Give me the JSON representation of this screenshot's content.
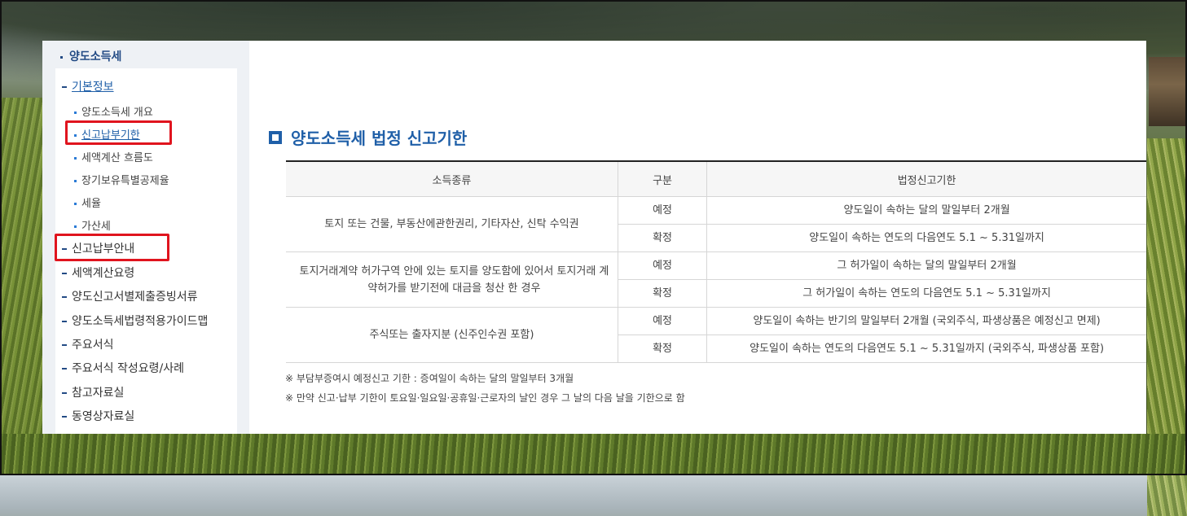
{
  "sidebar": {
    "title": "양도소득세",
    "sections": [
      {
        "label": "기본정보"
      },
      {
        "label": "신고납부안내"
      },
      {
        "label": "세액계산요령"
      },
      {
        "label": "양도신고서별제출증빙서류"
      },
      {
        "label": "양도소득세법령적용가이드맵"
      },
      {
        "label": "주요서식"
      },
      {
        "label": "주요서식 작성요령/사례"
      },
      {
        "label": "참고자료실"
      },
      {
        "label": "동영상자료실"
      }
    ],
    "sub_items": [
      {
        "label": "양도소득세 개요"
      },
      {
        "label": "신고납부기한"
      },
      {
        "label": "세액계산 흐름도"
      },
      {
        "label": "장기보유특별공제율"
      },
      {
        "label": "세율"
      },
      {
        "label": "가산세"
      }
    ]
  },
  "main": {
    "heading": "양도소득세 법정 신고기한",
    "table": {
      "headers": [
        "소득종류",
        "구분",
        "법정신고기한"
      ],
      "groups": [
        {
          "kind": "토지 또는 건물, 부동산에관한권리, 기타자산, 신탁 수익권",
          "rows": [
            {
              "type": "예정",
              "deadline": "양도일이 속하는 달의 말일부터 2개월"
            },
            {
              "type": "확정",
              "deadline": "양도일이 속하는 연도의 다음연도 5.1 ~ 5.31일까지"
            }
          ]
        },
        {
          "kind": "토지거래계약 허가구역 안에 있는 토지를 양도함에 있어서 토지거래 계약허가를 받기전에 대금을 청산 한 경우",
          "rows": [
            {
              "type": "예정",
              "deadline": "그 허가일이 속하는 달의 말일부터 2개월"
            },
            {
              "type": "확정",
              "deadline": "그 허가일이 속하는 연도의 다음연도 5.1 ~ 5.31일까지"
            }
          ]
        },
        {
          "kind": "주식또는 출자지분 (신주인수권 포함)",
          "rows": [
            {
              "type": "예정",
              "deadline": "양도일이 속하는 반기의 말일부터 2개월 (국외주식, 파생상품은 예정신고 면제)"
            },
            {
              "type": "확정",
              "deadline": "양도일이 속하는 연도의 다음연도 5.1 ~ 5.31일까지 (국외주식, 파생상품 포함)"
            }
          ]
        }
      ]
    },
    "notes": [
      "※ 부담부증여시 예정신고 기한 : 증여일이 속하는 달의 말일부터 3개월",
      "※ 만약 신고·납부 기한이 토요일·일요일·공휴일·근로자의 날인 경우 그 날의 다음 날을 기한으로 함"
    ]
  },
  "colors": {
    "accent": "#1f5fa8",
    "highlight_box": "#e0141e"
  }
}
